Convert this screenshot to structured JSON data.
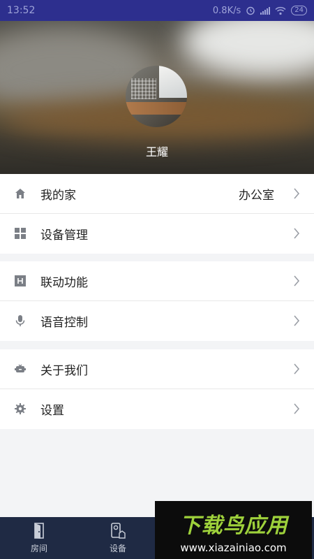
{
  "status_bar": {
    "time": "13:52",
    "network_speed": "0.8K/s",
    "battery": "24"
  },
  "header": {
    "user_name": "王耀"
  },
  "menu": {
    "group1": [
      {
        "label": "我的家",
        "value": "办公室",
        "icon": "home-icon"
      },
      {
        "label": "设备管理",
        "icon": "grid-icon"
      }
    ],
    "group2": [
      {
        "label": "联动功能",
        "icon": "linkage-icon"
      },
      {
        "label": "语音控制",
        "icon": "microphone-icon"
      }
    ],
    "group3": [
      {
        "label": "关于我们",
        "icon": "robot-icon"
      },
      {
        "label": "设置",
        "icon": "gear-icon"
      }
    ]
  },
  "bottom_nav": {
    "items": [
      {
        "label": "房间",
        "icon": "door-icon"
      },
      {
        "label": "设备",
        "icon": "device-icon"
      }
    ]
  },
  "watermark": {
    "title": "下载鸟应用",
    "url": "www.xiazainiao.com"
  },
  "colors": {
    "status_bar": "#2d2f8e",
    "bottom_nav": "#1f2a44",
    "icon_gray": "#7b7f86",
    "watermark_green": "#9ed13b"
  }
}
